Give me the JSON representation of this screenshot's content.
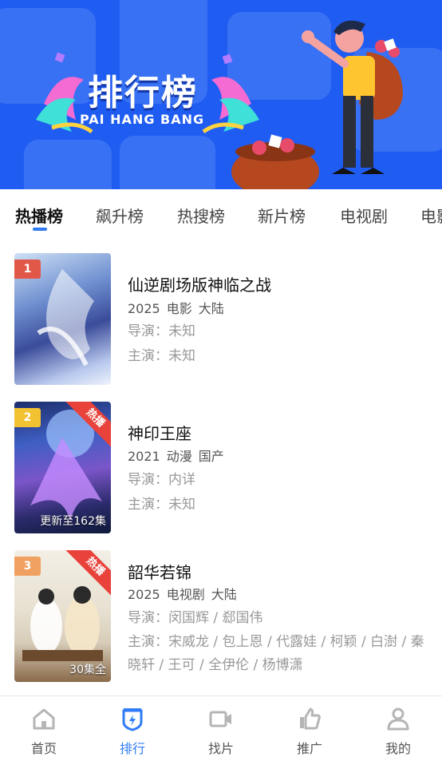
{
  "banner": {
    "title": "排行榜",
    "subtitle": "PAI HANG BANG",
    "background": "#1f5cf2"
  },
  "tabs": [
    {
      "label": "热播榜",
      "active": true
    },
    {
      "label": "飙升榜"
    },
    {
      "label": "热搜榜"
    },
    {
      "label": "新片榜"
    },
    {
      "label": "电视剧"
    },
    {
      "label": "电影"
    }
  ],
  "list": [
    {
      "rank": "1",
      "rank_color": "#e25848",
      "title": "仙逆剧场版神临之战",
      "year": "2025",
      "genre": "电影",
      "region": "大陆",
      "director": "导演：未知",
      "cast": "主演：未知",
      "poster_status": "",
      "hot": ""
    },
    {
      "rank": "2",
      "rank_color": "#f2c232",
      "title": "神印王座",
      "year": "2021",
      "genre": "动漫",
      "region": "国产",
      "director": "导演：内详",
      "cast": "主演：未知",
      "poster_status": "更新至162集",
      "hot": "热播"
    },
    {
      "rank": "3",
      "rank_color": "#f0a060",
      "title": "韶华若锦",
      "year": "2025",
      "genre": "电视剧",
      "region": "大陆",
      "director": "导演：闵国辉 / 郄国伟",
      "cast": "主演：宋威龙 / 包上恩 / 代露娃 / 柯颖 / 白澍 / 秦晓轩 / 王可 / 全伊伦 / 杨博潇",
      "poster_status": "30集全",
      "hot": "热播"
    }
  ],
  "nav": [
    {
      "label": "首页",
      "icon": "home-icon"
    },
    {
      "label": "排行",
      "icon": "ranking-icon",
      "active": true
    },
    {
      "label": "找片",
      "icon": "video-camera-icon"
    },
    {
      "label": "推广",
      "icon": "thumbs-up-icon"
    },
    {
      "label": "我的",
      "icon": "user-icon"
    }
  ],
  "colors": {
    "accent": "#2f7cf6",
    "hot_ribbon": "#e8423a"
  }
}
